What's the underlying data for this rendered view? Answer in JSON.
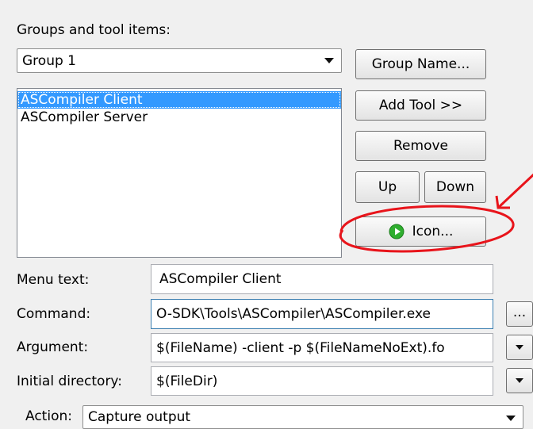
{
  "groups": {
    "label": "Groups and tool items:",
    "selected_group": "Group 1",
    "items": [
      {
        "label": "ASCompiler Client",
        "selected": true
      },
      {
        "label": "ASCompiler  Server",
        "selected": false
      }
    ]
  },
  "buttons": {
    "group_name": "Group Name...",
    "add_tool": "Add Tool >>",
    "remove": "Remove",
    "up": "Up",
    "down": "Down",
    "icon": "Icon...",
    "browse": "..."
  },
  "fields": {
    "menu_text_label": "Menu text:",
    "menu_text_value": "ASCompiler Client",
    "command_label": "Command:",
    "command_value": "O-SDK\\Tools\\ASCompiler\\ASCompiler.exe",
    "argument_label": "Argument:",
    "argument_value": "$(FileName) -client -p $(FileNameNoExt).fo",
    "initial_dir_label": "Initial directory:",
    "initial_dir_value": "$(FileDir)",
    "action_label": "Action:",
    "action_value": "Capture output"
  },
  "annotation": {
    "color": "#e8141b"
  },
  "colors": {
    "selection": "#3399ff",
    "icon_green": "#2fae2f"
  }
}
